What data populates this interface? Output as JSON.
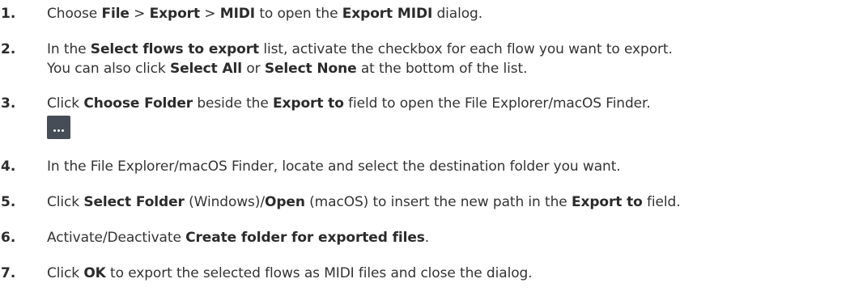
{
  "steps": [
    {
      "number": "1.",
      "t1": "Choose ",
      "b1": "File",
      "t2": " > ",
      "b2": "Export",
      "t3": " > ",
      "b3": "MIDI",
      "t4": " to open the ",
      "b4": "Export MIDI",
      "t5": " dialog."
    },
    {
      "number": "2.",
      "t1": "In the ",
      "b1": "Select flows to export",
      "t2": " list, activate the checkbox for each flow you want to export.",
      "t3": "You can also click ",
      "b2": "Select All",
      "t4": " or ",
      "b3": "Select None",
      "t5": " at the bottom of the list."
    },
    {
      "number": "3.",
      "t1": "Click ",
      "b1": "Choose Folder",
      "t2": " beside the ",
      "b2": "Export to",
      "t3": " field to open the File Explorer/macOS Finder.",
      "button_icon": "ellipsis-icon"
    },
    {
      "number": "4.",
      "t1": "In the File Explorer/macOS Finder, locate and select the destination folder you want."
    },
    {
      "number": "5.",
      "t1": "Click ",
      "b1": "Select Folder",
      "t2": " (Windows)/",
      "b2": "Open",
      "t3": " (macOS) to insert the new path in the ",
      "b3": "Export to",
      "t4": " field."
    },
    {
      "number": "6.",
      "t1": "Activate/Deactivate ",
      "b1": "Create folder for exported files",
      "t2": "."
    },
    {
      "number": "7.",
      "t1": "Click ",
      "b1": "OK",
      "t2": " to export the selected flows as MIDI files and close the dialog."
    }
  ],
  "colors": {
    "text": "#333333",
    "button_bg": "#464d56",
    "button_fg": "#ffffff"
  }
}
